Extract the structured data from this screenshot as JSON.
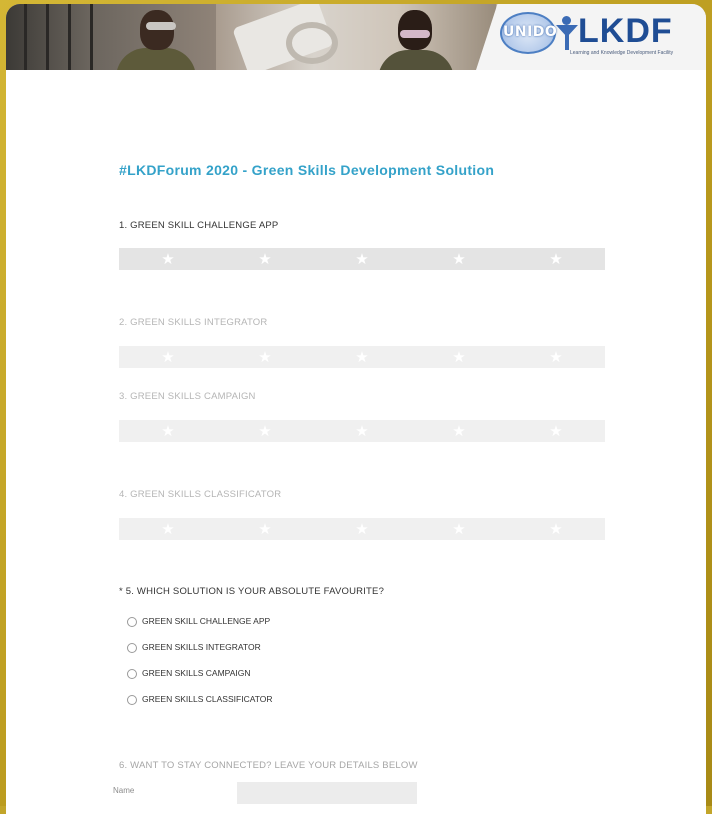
{
  "banner": {
    "logo_un": "UNIDO",
    "logo_main": "LKDF",
    "logo_sub": "Learning and Knowledge Development Facility"
  },
  "survey": {
    "title": "#LKDForum 2020 - Green Skills Development Solution",
    "questions": [
      {
        "label": "1. GREEN SKILL CHALLENGE APP",
        "rating": 0,
        "max": 5
      },
      {
        "label": "2. GREEN SKILLS INTEGRATOR",
        "rating": 0,
        "max": 5
      },
      {
        "label": "3. GREEN SKILLS CAMPAIGN",
        "rating": 0,
        "max": 5
      },
      {
        "label": "4. GREEN SKILLS CLASSIFICATOR",
        "rating": 0,
        "max": 5
      }
    ],
    "favourite": {
      "label": "* 5. WHICH SOLUTION IS YOUR ABSOLUTE FAVOURITE?",
      "options": [
        "GREEN SKILL CHALLENGE APP",
        "GREEN SKILLS INTEGRATOR",
        "GREEN SKILLS CAMPAIGN",
        "GREEN SKILLS CLASSIFICATOR"
      ]
    },
    "connect": {
      "label": "6. WANT TO STAY CONNECTED? LEAVE YOUR DETAILS BELOW",
      "name_label": "Name",
      "name_value": ""
    }
  },
  "icons": {
    "star": "star-icon",
    "radio": "radio-circle"
  },
  "colors": {
    "title": "#34a2c9",
    "frame": "#c2a52a",
    "rating_bar": "#e4e4e4"
  }
}
